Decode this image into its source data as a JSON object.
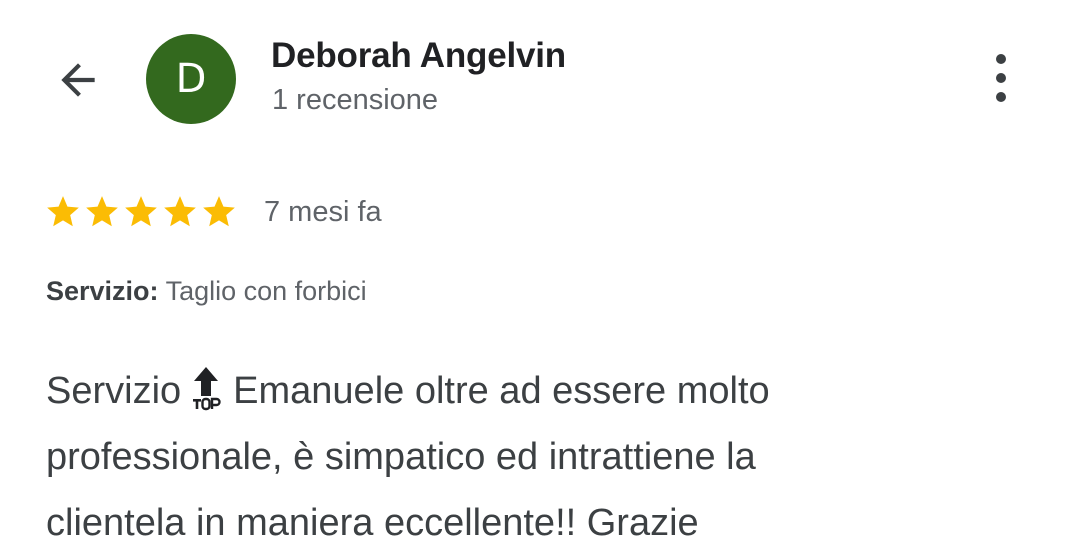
{
  "header": {
    "back_icon": "arrow-left-icon",
    "avatar_letter": "D",
    "avatar_color": "#33691e",
    "author_name": "Deborah Angelvin",
    "review_count": "1 recensione",
    "more_icon": "more-vert-icon"
  },
  "review": {
    "rating": 5,
    "rating_max": 5,
    "star_color": "#fbbc04",
    "time_ago": "7 mesi fa",
    "service_label": "Servizio:",
    "service_value": "Taglio con forbici",
    "text_line1_a": "Servizio",
    "text_emoji": "top-arrow-emoji",
    "text_line1_b": "Emanuele oltre ad essere molto",
    "text_line2": "professionale, è simpatico ed intrattiene la",
    "text_line3": "clientela in maniera eccellente!! Grazie"
  }
}
